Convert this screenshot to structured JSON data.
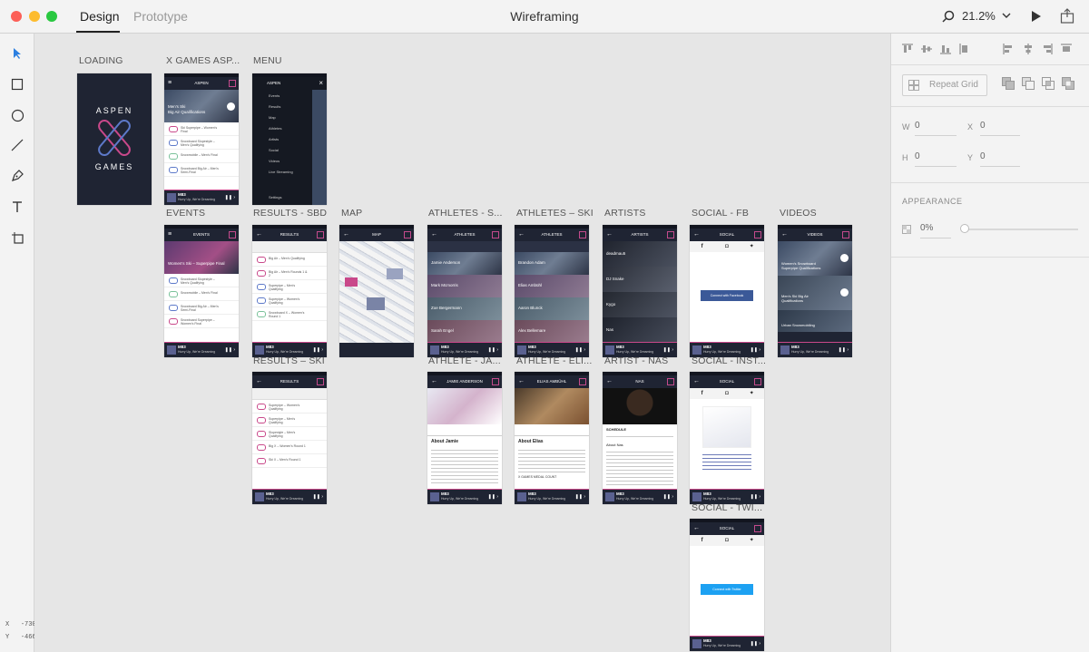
{
  "window": {
    "title": "Wireframing"
  },
  "tabs": {
    "design": "Design",
    "prototype": "Prototype"
  },
  "zoom": {
    "value": "21.2%"
  },
  "cursor": {
    "x_label": "X",
    "x_value": "-730",
    "y_label": "Y",
    "y_value": "-466"
  },
  "properties": {
    "repeat_grid": "Repeat Grid",
    "w_label": "W",
    "w_value": "0",
    "x_label": "X",
    "x_value": "0",
    "h_label": "H",
    "h_value": "0",
    "y_label": "Y",
    "y_value": "0",
    "appearance_title": "APPEARANCE",
    "opacity_value": "0%"
  },
  "artboards": {
    "loading": {
      "label": "LOADING",
      "line1": "ASPEN",
      "line2": "GAMES"
    },
    "xgames": {
      "label": "X GAMES ASP...",
      "header": "ASPEN",
      "hero_line1": "Men's Ski",
      "hero_line2": "Big Air Qualifications",
      "rows": [
        "Ski Superpipe – Women's Final",
        "Snowboard Slopestyle – Men's Qualifying",
        "Snowmobile – Men's Final",
        "Snowboard Big Air – Men's Semi-Final"
      ]
    },
    "menu": {
      "label": "MENU",
      "header": "ASPEN",
      "items": [
        "Events",
        "Results",
        "Map",
        "Athletes",
        "Artists",
        "Social",
        "Videos",
        "Live Streaming"
      ],
      "settings": "Settings"
    },
    "events": {
      "label": "EVENTS",
      "header": "EVENTS",
      "hero_line1": "Women's Ski – Superpipe Final",
      "rows": [
        "Snowboard Slopestyle – Men's Qualifying",
        "Snowmobile – Men's Final",
        "Snowboard Big Air – Men's Semi-Final",
        "Snowboard Superpipe – Women's Final"
      ]
    },
    "results_sbd": {
      "label": "RESULTS - SBD",
      "header": "RESULTS",
      "rows": [
        "Big Air – Men's Qualifying",
        "Big Air – Men's Rounds 1 & 2",
        "Superpipe – Men's Qualifying",
        "Superpipe – Women's Qualifying",
        "Snowboard X – Women's Round 1"
      ]
    },
    "results_ski": {
      "label": "RESULTS – SKI",
      "header": "RESULTS",
      "rows": [
        "Superpipe – Women's Qualifying",
        "Superpipe – Men's Qualifying",
        "Slopestyle – Men's Qualifying",
        "Big X – Women's Round 1",
        "Ski X – Men's Round 1"
      ]
    },
    "map": {
      "label": "MAP",
      "header": "MAP"
    },
    "athletes_s": {
      "label": "ATHLETES - S...",
      "header": "ATHLETES",
      "names": [
        "Jamie Anderson",
        "Mark Mcmorris",
        "Zoe Bergermann",
        "Sarah Engel"
      ]
    },
    "athletes_ski": {
      "label": "ATHLETES – SKI",
      "header": "ATHLETES",
      "names": [
        "Brandon Adam",
        "Elias Ambühl",
        "Aaron Blunck",
        "Alex Bellemare"
      ]
    },
    "artists": {
      "label": "ARTISTS",
      "header": "ARTISTS",
      "names": [
        "deadmau5",
        "DJ Snake",
        "Kygo",
        "Nas"
      ]
    },
    "social_fb": {
      "label": "SOCIAL - FB",
      "header": "SOCIAL",
      "button": "Connect with Facebook"
    },
    "videos": {
      "label": "VIDEOS",
      "header": "VIDEOS",
      "items": [
        "Women's Snowboard Superpipe Qualifications",
        "Men's Ski Big Air Qualifications",
        "Urban Snowmobiling"
      ]
    },
    "athlete_ja": {
      "label": "ATHLETE - JA...",
      "header": "JAMIE ANDERSON",
      "about": "About Jamie"
    },
    "athlete_eli": {
      "label": "ATHLETE - ELI...",
      "header": "ELIAS AMBÜHL",
      "about": "About Elias",
      "medals": "X GAMES MEDAL COUNT"
    },
    "artist_nas": {
      "label": "ARTIST - NAS",
      "header": "NAS",
      "schedule": "SCHEDULE",
      "about": "About Nas"
    },
    "social_inst": {
      "label": "SOCIAL - INST...",
      "header": "SOCIAL"
    },
    "social_twi": {
      "label": "SOCIAL - TWI...",
      "header": "SOCIAL",
      "button": "Connect with Twitter"
    }
  },
  "player": {
    "artist": "M83",
    "song": "Hurry Up, We're Dreaming"
  },
  "colors": {
    "accent": "#c9488a",
    "navy": "#1f2433",
    "facebook": "#3b5998",
    "twitter": "#1da1f2"
  }
}
